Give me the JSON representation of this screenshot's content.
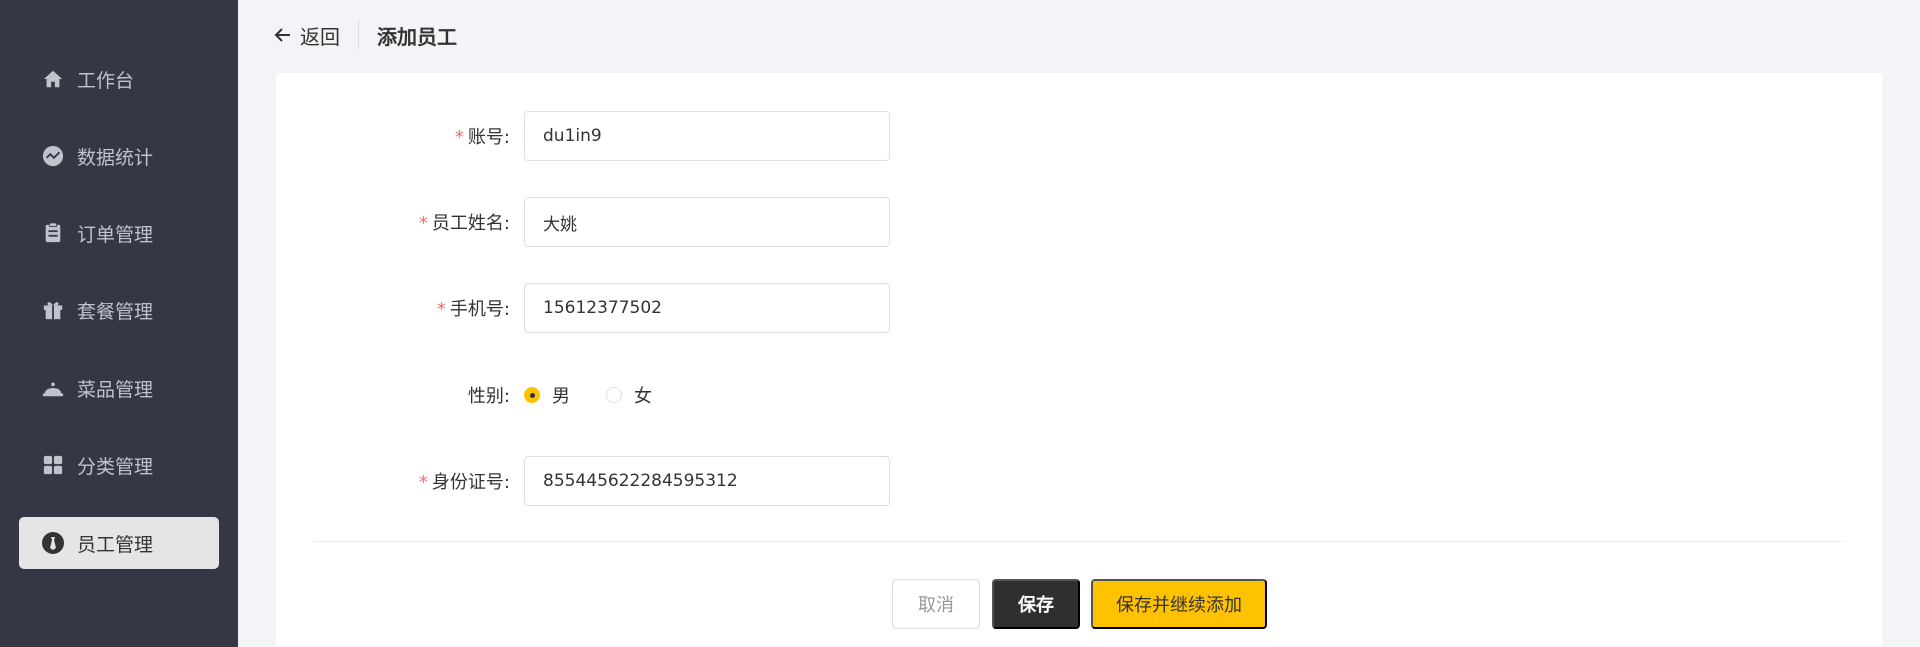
{
  "sidebar": {
    "items": [
      {
        "label": "工作台",
        "icon": "home-icon",
        "active": false
      },
      {
        "label": "数据统计",
        "icon": "chart-line-icon",
        "active": false
      },
      {
        "label": "订单管理",
        "icon": "clipboard-icon",
        "active": false
      },
      {
        "label": "套餐管理",
        "icon": "gift-icon",
        "active": false
      },
      {
        "label": "菜品管理",
        "icon": "cloche-icon",
        "active": false
      },
      {
        "label": "分类管理",
        "icon": "grid-icon",
        "active": false
      },
      {
        "label": "员工管理",
        "icon": "employee-icon",
        "active": true
      }
    ]
  },
  "header": {
    "back_label": "返回",
    "title": "添加员工"
  },
  "form": {
    "account": {
      "label": "账号:",
      "value": "du1in9"
    },
    "name": {
      "label": "员工姓名:",
      "value": "大姚"
    },
    "phone": {
      "label": "手机号:",
      "value": "15612377502"
    },
    "gender": {
      "label": "性别:",
      "options": [
        "男",
        "女"
      ],
      "selected": "男"
    },
    "id_number": {
      "label": "身份证号:",
      "value": "855445622284595312"
    },
    "required_mark": "*"
  },
  "actions": {
    "cancel": "取消",
    "save": "保存",
    "save_continue": "保存并继续添加"
  },
  "colors": {
    "sidebar_bg": "#343744",
    "accent": "#ffc200",
    "dark_button": "#2f2f2f",
    "required": "#f56c6c"
  }
}
